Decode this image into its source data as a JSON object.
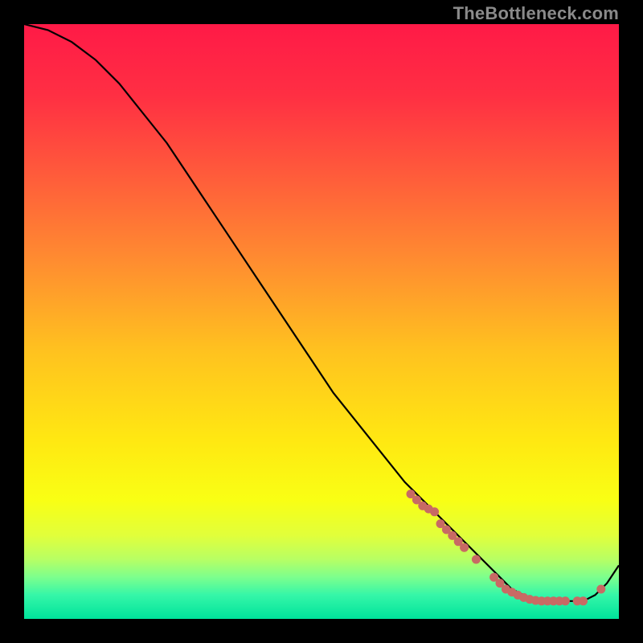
{
  "watermark": "TheBottleneck.com",
  "chart_data": {
    "type": "line",
    "xlim": [
      0,
      100
    ],
    "ylim": [
      0,
      100
    ],
    "title": "",
    "xlabel": "",
    "ylabel": "",
    "series": [
      {
        "name": "curve",
        "x": [
          0,
          4,
          8,
          12,
          16,
          20,
          24,
          28,
          32,
          36,
          40,
          44,
          48,
          52,
          56,
          60,
          64,
          68,
          72,
          76,
          78,
          80,
          82,
          84,
          86,
          88,
          90,
          92,
          94,
          96,
          98,
          100
        ],
        "y": [
          100,
          99,
          97,
          94,
          90,
          85,
          80,
          74,
          68,
          62,
          56,
          50,
          44,
          38,
          33,
          28,
          23,
          19,
          15,
          11,
          9,
          7,
          5,
          4,
          3,
          3,
          3,
          3,
          3,
          4,
          6,
          9
        ]
      }
    ],
    "markers": {
      "name": "dotted-segment",
      "x": [
        65,
        66,
        67,
        68,
        69,
        70,
        71,
        72,
        73,
        74,
        76,
        79,
        80,
        81,
        82,
        83,
        84,
        85,
        86,
        87,
        88,
        89,
        90,
        91,
        93,
        94,
        97
      ],
      "y": [
        21,
        20,
        19,
        18.5,
        18,
        16,
        15,
        14,
        13,
        12,
        10,
        7,
        6,
        5,
        4.5,
        4,
        3.6,
        3.3,
        3.1,
        3,
        3,
        3,
        3,
        3,
        3,
        3,
        5
      ]
    },
    "background": {
      "type": "vertical-gradient",
      "stops": [
        {
          "pos": 0.0,
          "color": "#ff1a47"
        },
        {
          "pos": 0.12,
          "color": "#ff2f43"
        },
        {
          "pos": 0.25,
          "color": "#ff5a3b"
        },
        {
          "pos": 0.4,
          "color": "#ff8d30"
        },
        {
          "pos": 0.55,
          "color": "#ffc21f"
        },
        {
          "pos": 0.7,
          "color": "#ffe812"
        },
        {
          "pos": 0.8,
          "color": "#f9ff14"
        },
        {
          "pos": 0.86,
          "color": "#e1ff3b"
        },
        {
          "pos": 0.9,
          "color": "#b7ff64"
        },
        {
          "pos": 0.93,
          "color": "#7cff8d"
        },
        {
          "pos": 0.96,
          "color": "#35f6a8"
        },
        {
          "pos": 1.0,
          "color": "#00e39b"
        }
      ]
    },
    "colors": {
      "curve": "#000000",
      "marker": "#c86a64",
      "canvas": "#000000",
      "watermark": "#8a8a8a"
    }
  }
}
